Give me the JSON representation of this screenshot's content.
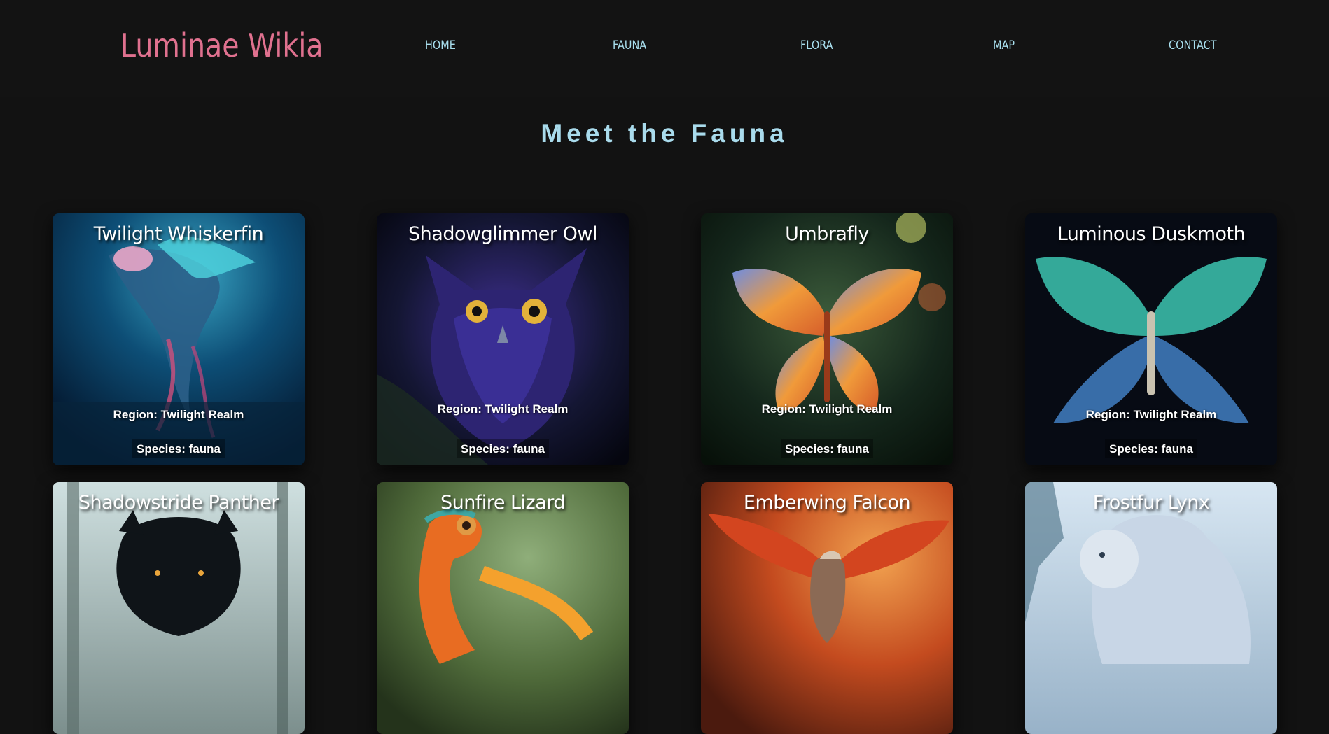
{
  "header": {
    "logo": "Luminae Wikia",
    "nav": [
      "HOME",
      "FAUNA",
      "FLORA",
      "MAP",
      "CONTACT"
    ]
  },
  "page_title": "Meet the Fauna",
  "cards": [
    {
      "name": "Twilight Whiskerfin",
      "region": "Region: Twilight Realm",
      "species": "Species: fauna"
    },
    {
      "name": "Shadowglimmer Owl",
      "region": "Region: Twilight Realm",
      "species": "Species: fauna"
    },
    {
      "name": "Umbrafly",
      "region": "Region: Twilight Realm",
      "species": "Species: fauna"
    },
    {
      "name": "Luminous Duskmoth",
      "region": "Region: Twilight Realm",
      "species": "Species: fauna"
    },
    {
      "name": "Shadowstride Panther",
      "region": "",
      "species": ""
    },
    {
      "name": "Sunfire Lizard",
      "region": "",
      "species": ""
    },
    {
      "name": "Emberwing Falcon",
      "region": "",
      "species": ""
    },
    {
      "name": "Frostfur Lynx",
      "region": "",
      "species": ""
    }
  ],
  "colors": {
    "background": "#121212",
    "logo": "#e0718f",
    "nav": "#a9dfee",
    "title": "#a9dbec"
  }
}
